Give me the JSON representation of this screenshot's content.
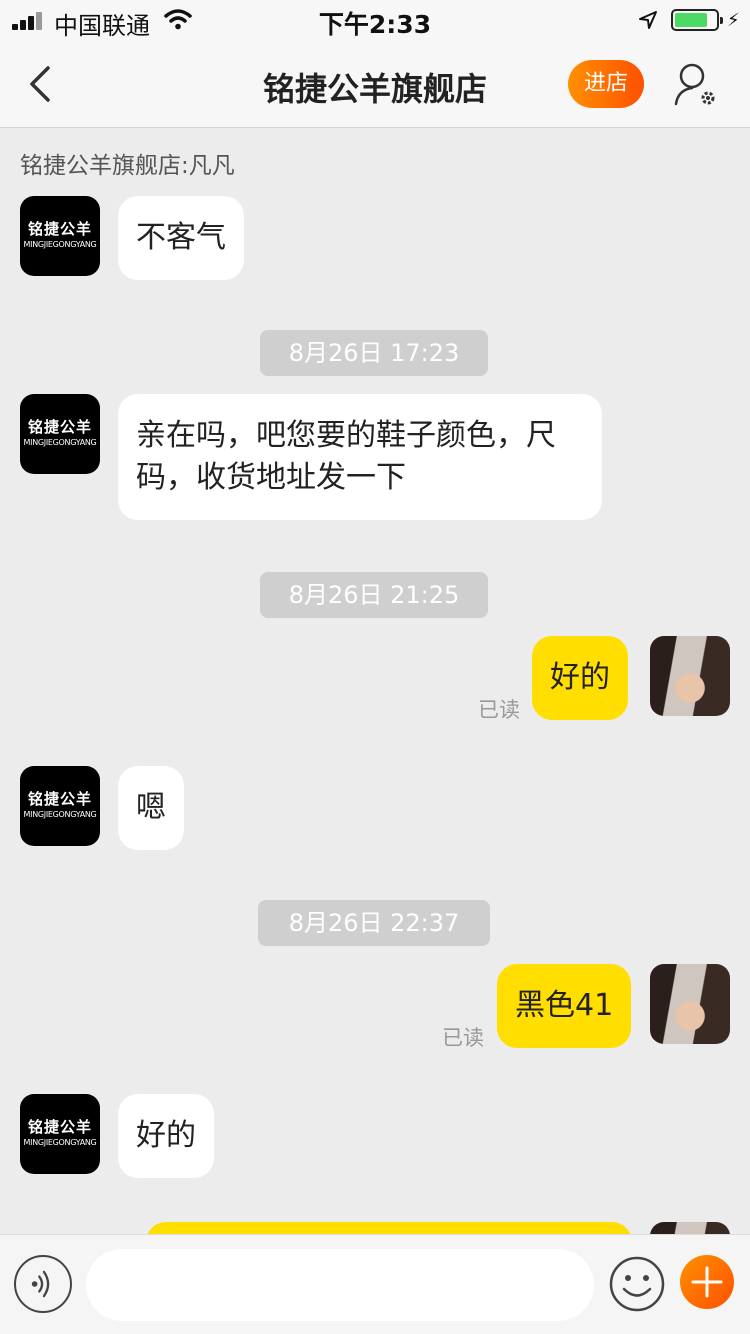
{
  "status_bar": {
    "carrier": "中国联通",
    "time": "下午2:33"
  },
  "header": {
    "title": "铭捷公羊旗舰店",
    "enter_store_label": "进店"
  },
  "chat": {
    "sender_label": "铭捷公羊旗舰店:凡凡",
    "shop_avatar": {
      "logo_cn": "铭捷公羊",
      "logo_en": "MINGJIEGONGYANG"
    },
    "msg1": "不客气",
    "ts1": "8月26日 17:23",
    "msg2": "亲在吗，吧您要的鞋子颜色，尺码，收货地址发一下",
    "ts2": "8月26日 21:25",
    "msg3": "好的",
    "read3": "已读",
    "msg4": "嗯",
    "ts3": "8月26日 22:37",
    "msg5": "黑色41",
    "read5": "已读",
    "msg6": "好的"
  },
  "input_bar": {
    "placeholder": ""
  },
  "colors": {
    "accent": "#ff5000",
    "outgoing_bubble": "#ffde00",
    "background": "#ececec"
  }
}
